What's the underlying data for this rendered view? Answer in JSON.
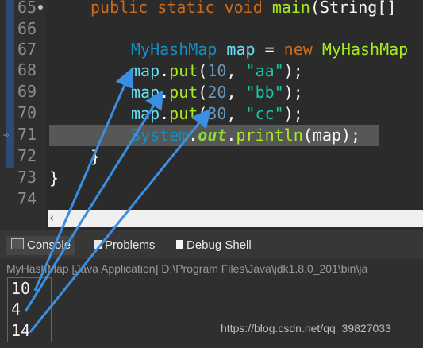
{
  "editor": {
    "line_numbers": [
      "65",
      "66",
      "67",
      "68",
      "69",
      "70",
      "71",
      "72",
      "73",
      "74"
    ],
    "lines": {
      "l65": {
        "kw1": "public",
        "kw2": "static",
        "kw3": "void",
        "name": "main",
        "rest": "(String[]"
      },
      "l67": {
        "type": "MyHashMap",
        "var": "map",
        "eq": " = ",
        "kw": "new",
        "ctor": "MyHashMap"
      },
      "l68": {
        "var": "map",
        "dot": ".",
        "meth": "put",
        "open": "(",
        "num": "10",
        "comma": ", ",
        "str": "\"aa\"",
        "close": ");"
      },
      "l69": {
        "var": "map",
        "dot": ".",
        "meth": "put",
        "open": "(",
        "num": "20",
        "comma": ", ",
        "str": "\"bb\"",
        "close": ");"
      },
      "l70": {
        "var": "map",
        "dot": ".",
        "meth": "put",
        "open": "(",
        "num": "30",
        "comma": ", ",
        "str": "\"cc\"",
        "close": ");"
      },
      "l71": {
        "cls": "System",
        "dot1": ".",
        "fld": "out",
        "dot2": ".",
        "meth": "println",
        "open": "(",
        "arg": "map",
        "close": ");"
      },
      "l72": "}",
      "l73": "}"
    }
  },
  "console": {
    "tabs": [
      "Console",
      "Problems",
      "Debug Shell"
    ],
    "description": "MyHashMap [Java Application] D:\\Program Files\\Java\\jdk1.8.0_201\\bin\\ja",
    "output": [
      "10",
      "4",
      "14"
    ]
  },
  "watermark": "https://blog.csdn.net/qq_39827033",
  "colors": {
    "arrow": "#3a8fe0",
    "output_box": "#e03232",
    "highlight": "#575757"
  }
}
